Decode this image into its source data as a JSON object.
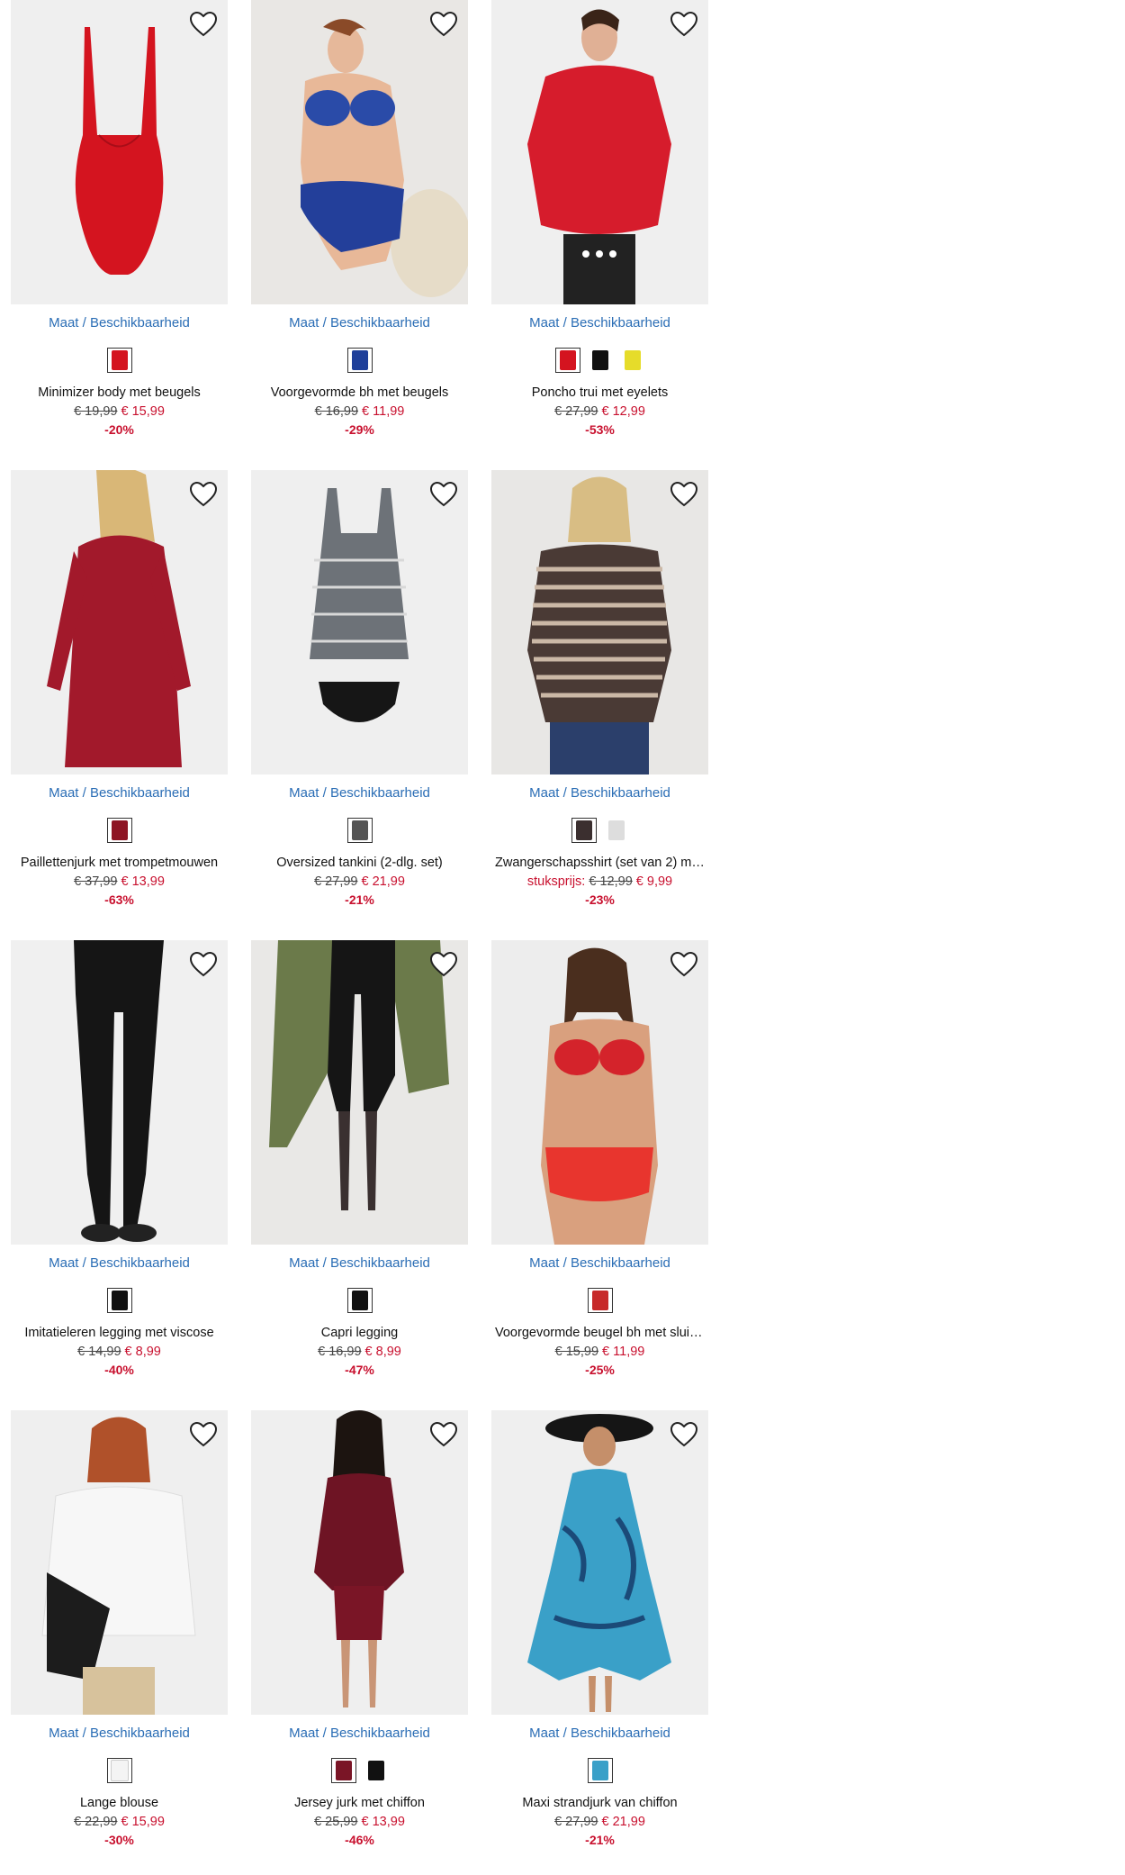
{
  "colors": {
    "accent": "#2a6db5",
    "sale": "#c8102e",
    "image_bg": "#ececec"
  },
  "products": [
    {
      "size_link": "Maat / Beschikbaarheid",
      "title": "Minimizer body met beugels",
      "old_price": "€ 19,99",
      "new_price": "€ 15,99",
      "discount": "-20%",
      "unit_label": "",
      "image": "red-bodysuit",
      "swatches": [
        "#d4141f"
      ],
      "wishlist_icon": "heart-outline-icon"
    },
    {
      "size_link": "Maat / Beschikbaarheid",
      "title": "Voorgevormde bh met beugels",
      "old_price": "€ 16,99",
      "new_price": "€ 11,99",
      "discount": "-29%",
      "unit_label": "",
      "image": "model-blue-lingerie",
      "swatches": [
        "#1f3f9a"
      ],
      "wishlist_icon": "heart-outline-icon"
    },
    {
      "size_link": "Maat / Beschikbaarheid",
      "title": "Poncho trui met eyelets",
      "old_price": "€ 27,99",
      "new_price": "€ 12,99",
      "discount": "-53%",
      "unit_label": "",
      "image": "model-red-poncho",
      "swatches": [
        "#d4141f",
        "#111111",
        "#e6dc2a"
      ],
      "wishlist_icon": "heart-outline-icon"
    },
    {
      "size_link": "Maat / Beschikbaarheid",
      "title": "Paillettenjurk met trompetmouwen",
      "old_price": "€ 37,99",
      "new_price": "€ 13,99",
      "discount": "-63%",
      "unit_label": "",
      "image": "model-sequin-dress",
      "swatches": [
        "#8e1524"
      ],
      "wishlist_icon": "heart-outline-icon"
    },
    {
      "size_link": "Maat / Beschikbaarheid",
      "title": "Oversized tankini (2-dlg. set)",
      "old_price": "€ 27,99",
      "new_price": "€ 21,99",
      "discount": "-21%",
      "unit_label": "",
      "image": "patterned-tankini",
      "swatches": [
        "#555555"
      ],
      "wishlist_icon": "heart-outline-icon"
    },
    {
      "size_link": "Maat / Beschikbaarheid",
      "title": "Zwangerschapsshirt (set van 2) met…",
      "old_price": "€ 12,99",
      "new_price": "€ 9,99",
      "discount": "-23%",
      "unit_label": "stuksprijs:",
      "image": "model-striped-shirt",
      "swatches": [
        "#3b2f2f",
        "#dddddd"
      ],
      "wishlist_icon": "heart-outline-icon"
    },
    {
      "size_link": "Maat / Beschikbaarheid",
      "title": "Imitatieleren legging met viscose",
      "old_price": "€ 14,99",
      "new_price": "€ 8,99",
      "discount": "-40%",
      "unit_label": "",
      "image": "black-leather-legging",
      "swatches": [
        "#111111"
      ],
      "wishlist_icon": "heart-outline-icon"
    },
    {
      "size_link": "Maat / Beschikbaarheid",
      "title": "Capri legging",
      "old_price": "€ 16,99",
      "new_price": "€ 8,99",
      "discount": "-47%",
      "unit_label": "",
      "image": "model-capri-legging",
      "swatches": [
        "#111111"
      ],
      "wishlist_icon": "heart-outline-icon"
    },
    {
      "size_link": "Maat / Beschikbaarheid",
      "title": "Voorgevormde beugel bh met sluiti…",
      "old_price": "€ 15,99",
      "new_price": "€ 11,99",
      "discount": "-25%",
      "unit_label": "",
      "image": "model-red-lace-lingerie",
      "swatches": [
        "#c72a2a"
      ],
      "wishlist_icon": "heart-outline-icon"
    },
    {
      "size_link": "Maat / Beschikbaarheid",
      "title": "Lange blouse",
      "old_price": "€ 22,99",
      "new_price": "€ 15,99",
      "discount": "-30%",
      "unit_label": "",
      "image": "model-white-blouse",
      "swatches": [
        "#f4f4f4"
      ],
      "wishlist_icon": "heart-outline-icon"
    },
    {
      "size_link": "Maat / Beschikbaarheid",
      "title": "Jersey jurk met chiffon",
      "old_price": "€ 25,99",
      "new_price": "€ 13,99",
      "discount": "-46%",
      "unit_label": "",
      "image": "model-burgundy-dress",
      "swatches": [
        "#7a1526",
        "#111111"
      ],
      "wishlist_icon": "heart-outline-icon"
    },
    {
      "size_link": "Maat / Beschikbaarheid",
      "title": "Maxi strandjurk van chiffon",
      "old_price": "€ 27,99",
      "new_price": "€ 21,99",
      "discount": "-21%",
      "unit_label": "",
      "image": "model-blue-beach-dress",
      "swatches": [
        "#3aa0c8"
      ],
      "wishlist_icon": "heart-outline-icon"
    }
  ]
}
